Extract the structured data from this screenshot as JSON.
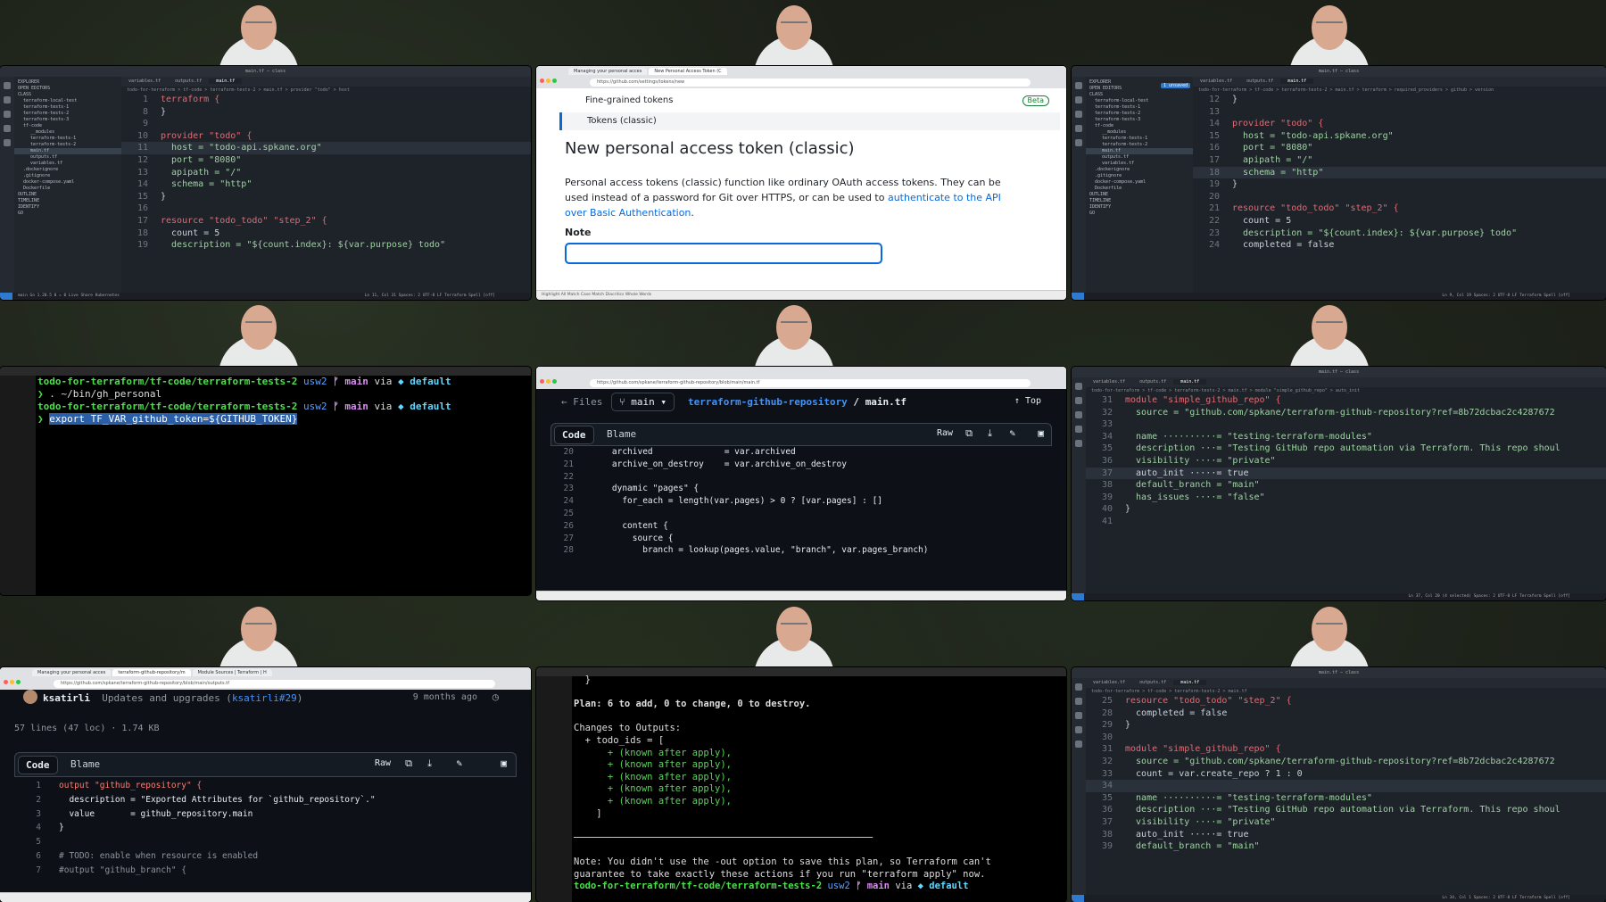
{
  "tile1": {
    "window_title": "main.tf — class",
    "sidebar": [
      "EXPLORER",
      "OPEN EDITORS",
      "CLASS",
      "terraform-local-test",
      "terraform-tests-1",
      "terraform-tests-2",
      "terraform-tests-3",
      "tf-code",
      "__modules",
      "terraform-tests-1",
      "terraform-tests-2",
      "main.tf",
      "outputs.tf",
      "variables.tf",
      ".dockerignore",
      ".gitignore",
      "docker-compose.yaml",
      "Dockerfile",
      "OUTLINE",
      "TIMELINE",
      "IDENTIFY",
      "GO"
    ],
    "tabs": [
      "variables.tf",
      "outputs.tf",
      "main.tf"
    ],
    "breadcrumb": "todo-for-terraform > tf-code > terraform-tests-2 > main.tf > provider \"todo\" > host",
    "lines": [
      {
        "n": "1",
        "t": "terraform {"
      },
      {
        "n": "8",
        "t": "}"
      },
      {
        "n": "9",
        "t": ""
      },
      {
        "n": "10",
        "t": "provider \"todo\" {"
      },
      {
        "n": "11",
        "t": "  host = \"todo-api.spkane.org\""
      },
      {
        "n": "12",
        "t": "  port = \"8080\""
      },
      {
        "n": "13",
        "t": "  apipath = \"/\""
      },
      {
        "n": "14",
        "t": "  schema = \"http\""
      },
      {
        "n": "15",
        "t": "}"
      },
      {
        "n": "16",
        "t": ""
      },
      {
        "n": "17",
        "t": "resource \"todo_todo\" \"step_2\" {"
      },
      {
        "n": "18",
        "t": "  count = 5"
      },
      {
        "n": "19",
        "t": "  description = \"${count.index}: ${var.purpose} todo\""
      }
    ],
    "status_left": "main   Go 1.20.5   0 ⚠ 0   Live Share   Kubernetes",
    "status_right": "Ln 11, Col 31   Spaces: 2   UTF-8   LF   Terraform   Spell   [off]"
  },
  "tile2": {
    "tabs": [
      "Managing your personal acces",
      "New Personal Access Token (C"
    ],
    "url": "https://github.com/settings/tokens/new",
    "menu_item_1": "Fine-grained tokens",
    "beta": "Beta",
    "menu_item_2": "Tokens (classic)",
    "heading": "New personal access token (classic)",
    "body": "Personal access tokens (classic) function like ordinary OAuth access tokens. They can be used instead of a password for Git over HTTPS, or can be used to ",
    "link": "authenticate to the API over Basic Authentication",
    "body_end": ".",
    "note_label": "Note",
    "findbar": "Highlight All   Match Case   Match Diacritics   Whole Words"
  },
  "tile3": {
    "window_title": "main.tf — class",
    "badge": "1 unsaved",
    "tabs": [
      "variables.tf",
      "outputs.tf",
      "main.tf"
    ],
    "breadcrumb": "todo-for-terraform > tf-code > terraform-tests-2 > main.tf > terraform > required_providers > github > version",
    "lines": [
      {
        "n": "12",
        "t": "}"
      },
      {
        "n": "13",
        "t": ""
      },
      {
        "n": "14",
        "t": "provider \"todo\" {"
      },
      {
        "n": "15",
        "t": "  host = \"todo-api.spkane.org\""
      },
      {
        "n": "16",
        "t": "  port = \"8080\""
      },
      {
        "n": "17",
        "t": "  apipath = \"/\""
      },
      {
        "n": "18",
        "t": "  schema = \"http\""
      },
      {
        "n": "19",
        "t": "}"
      },
      {
        "n": "20",
        "t": ""
      },
      {
        "n": "21",
        "t": "resource \"todo_todo\" \"step_2\" {"
      },
      {
        "n": "22",
        "t": "  count = 5"
      },
      {
        "n": "23",
        "t": "  description = \"${count.index}: ${var.purpose} todo\""
      },
      {
        "n": "24",
        "t": "  completed = false"
      }
    ],
    "status_right": "Ln 9, Col 19   Spaces: 2   UTF-8   LF   Terraform   Spell   [off]"
  },
  "tile4": {
    "lines": [
      {
        "path": "todo-for-terraform/tf-code/terraform-tests-2",
        "region": "usw2",
        "branch": "main",
        "via": "via",
        "ctx": "default"
      },
      {
        "cmd": ". ~/bin/gh_personal"
      },
      {
        "path": "todo-for-terraform/tf-code/terraform-tests-2",
        "region": "usw2",
        "branch": "main",
        "via": "via",
        "ctx": "default"
      },
      {
        "cmd": "export TF_VAR_github_token=${GITHUB_TOKEN}"
      }
    ]
  },
  "tile5": {
    "url": "https://github.com/spkane/terraform-github-repository/blob/main/main.tf",
    "files": "Files",
    "branch": "main",
    "repo": "terraform-github-repository",
    "sep": " / ",
    "file": "main.tf",
    "top": "Top",
    "code_tab": "Code",
    "blame_tab": "Blame",
    "raw": "Raw",
    "lines": [
      {
        "n": "20",
        "t": "    archived              = var.archived"
      },
      {
        "n": "21",
        "t": "    archive_on_destroy    = var.archive_on_destroy"
      },
      {
        "n": "22",
        "t": ""
      },
      {
        "n": "23",
        "t": "    dynamic \"pages\" {"
      },
      {
        "n": "24",
        "t": "      for_each = length(var.pages) > 0 ? [var.pages] : []"
      },
      {
        "n": "25",
        "t": ""
      },
      {
        "n": "26",
        "t": "      content {"
      },
      {
        "n": "27",
        "t": "        source {"
      },
      {
        "n": "28",
        "t": "          branch = lookup(pages.value, \"branch\", var.pages_branch)"
      }
    ]
  },
  "tile6": {
    "window_title": "main.tf — class",
    "tabs": [
      "variables.tf",
      "outputs.tf",
      "main.tf"
    ],
    "breadcrumb": "todo-for-terraform > tf-code > terraform-tests-2 > main.tf > module \"simple_github_repo\" > auto_init",
    "lines": [
      {
        "n": "31",
        "t": "module \"simple_github_repo\" {"
      },
      {
        "n": "32",
        "t": "  source = \"github.com/spkane/terraform-github-repository?ref=8b72dcbac2c4287672"
      },
      {
        "n": "33",
        "t": ""
      },
      {
        "n": "34",
        "t": "  name ··········= \"testing-terraform-modules\""
      },
      {
        "n": "35",
        "t": "  description ···= \"Testing GitHub repo automation via Terraform. This repo shoul"
      },
      {
        "n": "36",
        "t": "  visibility ····= \"private\""
      },
      {
        "n": "37",
        "t": "  auto_init ·····= true"
      },
      {
        "n": "38",
        "t": "  default_branch = \"main\""
      },
      {
        "n": "39",
        "t": "  has_issues ····= \"false\""
      },
      {
        "n": "40",
        "t": "}"
      },
      {
        "n": "41",
        "t": ""
      }
    ],
    "status_right": "Ln 37, Col 20 (4 selected)   Spaces: 2   UTF-8   LF   Terraform   Spell   [off]"
  },
  "tile7": {
    "tabs": [
      "Managing your personal acces",
      "terraform-github-repository/m",
      "Module Sources | Terraform | H"
    ],
    "url": "https://github.com/spkane/terraform-github-repository/blob/main/outputs.tf",
    "author": "ksatirli",
    "commit_msg": "Updates and upgrades (",
    "commit_ref": "ksatirli#29",
    "commit_close": ")",
    "time": "9 months ago",
    "meta": "57 lines (47 loc) · 1.74 KB",
    "code_tab": "Code",
    "blame_tab": "Blame",
    "raw": "Raw",
    "lines": [
      {
        "n": "1",
        "t": "output \"github_repository\" {"
      },
      {
        "n": "2",
        "t": "  description = \"Exported Attributes for `github_repository`.\""
      },
      {
        "n": "3",
        "t": "  value       = github_repository.main"
      },
      {
        "n": "4",
        "t": "}"
      },
      {
        "n": "5",
        "t": ""
      },
      {
        "n": "6",
        "t": "# TODO: enable when resource is enabled"
      },
      {
        "n": "7",
        "t": "#output \"github_branch\" {"
      }
    ]
  },
  "tile8": {
    "lines": [
      "  }",
      "",
      "Plan: 6 to add, 0 to change, 0 to destroy.",
      "",
      "Changes to Outputs:",
      "  + todo_ids = [",
      "      + (known after apply),",
      "      + (known after apply),",
      "      + (known after apply),",
      "      + (known after apply),",
      "      + (known after apply),",
      "    ]",
      "",
      "─────────────────────────────────────────────────────",
      "",
      "Note: You didn't use the -out option to save this plan, so Terraform can't",
      "guarantee to take exactly these actions if you run \"terraform apply\" now."
    ],
    "prompt": {
      "path": "todo-for-terraform/tf-code/terraform-tests-2",
      "region": "usw2",
      "branch": "main",
      "via": "via",
      "ctx": "default"
    }
  },
  "tile9": {
    "window_title": "main.tf — class",
    "tabs": [
      "variables.tf",
      "outputs.tf",
      "main.tf"
    ],
    "breadcrumb": "todo-for-terraform > tf-code > terraform-tests-2 > main.tf",
    "lines": [
      {
        "n": "25",
        "t": "resource \"todo_todo\" \"step_2\" {"
      },
      {
        "n": "28",
        "t": "  completed = false"
      },
      {
        "n": "29",
        "t": "}"
      },
      {
        "n": "30",
        "t": ""
      },
      {
        "n": "31",
        "t": "module \"simple_github_repo\" {"
      },
      {
        "n": "32",
        "t": "  source = \"github.com/spkane/terraform-github-repository?ref=8b72dcbac2c4287672"
      },
      {
        "n": "33",
        "t": "  count = var.create_repo ? 1 : 0"
      },
      {
        "n": "34",
        "t": ""
      },
      {
        "n": "35",
        "t": "  name ··········= \"testing-terraform-modules\""
      },
      {
        "n": "36",
        "t": "  description ···= \"Testing GitHub repo automation via Terraform. This repo shoul"
      },
      {
        "n": "37",
        "t": "  visibility ····= \"private\""
      },
      {
        "n": "38",
        "t": "  auto_init ·····= true"
      },
      {
        "n": "39",
        "t": "  default_branch = \"main\""
      }
    ],
    "status_right": "Ln 34, Col 1   Spaces: 2   UTF-8   LF   Terraform   Spell   [off]"
  },
  "colors": {
    "accent": "#2f7ad1",
    "terminal_green": "#4be04b",
    "github_link": "#0969da"
  }
}
